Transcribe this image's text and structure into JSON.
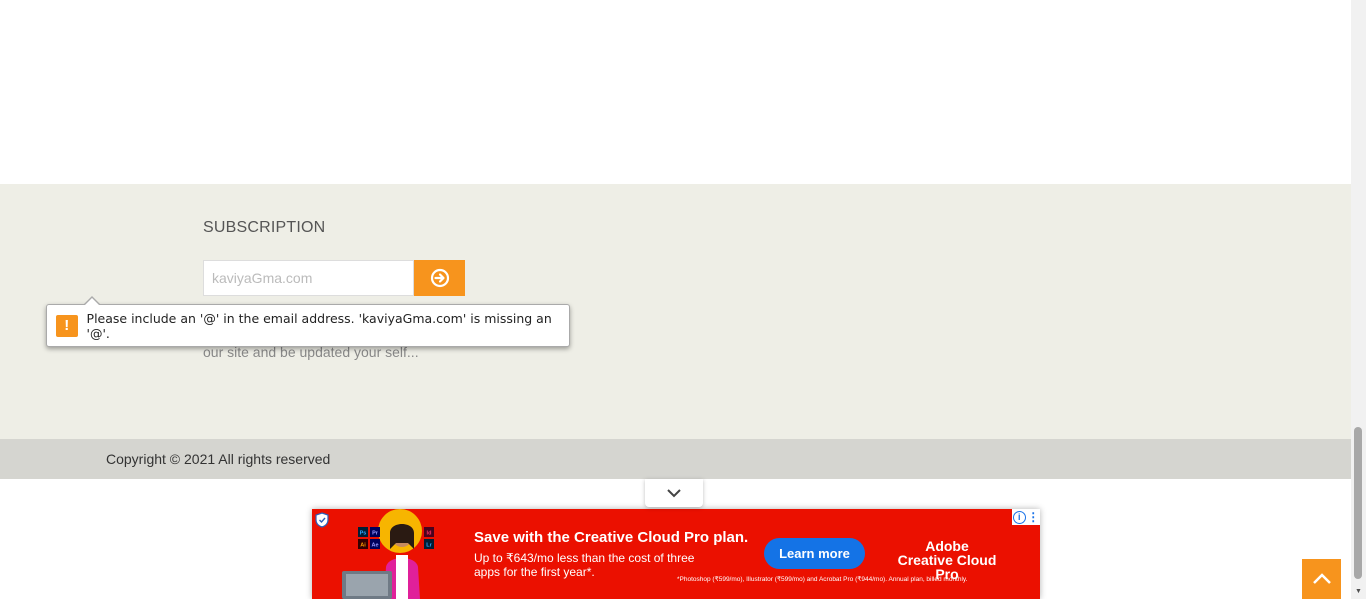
{
  "subscription": {
    "title": "SUBSCRIPTION",
    "email_value": "kaviyaGma.com",
    "submit_icon": "arrow-circle-right-icon",
    "description": "our site and be updated your self..."
  },
  "validation": {
    "icon": "warning-icon",
    "glyph": "!",
    "message": "Please include an '@' in the email address. 'kaviyaGma.com' is missing an '@'."
  },
  "footer": {
    "copyright": "Copyright © 2021 All rights reserved"
  },
  "ad": {
    "headline": "Save with the Creative Cloud Pro plan.",
    "subtext": "Up to ₹643/mo less than the cost of three apps for the first year*.",
    "cta": "Learn more",
    "brand_top": "Adobe",
    "brand_bottom": "Creative Cloud Pro",
    "fineprint": "*Photoshop (₹599/mo), Illustrator (₹599/mo) and Acrobat Pro (₹944/mo). Annual plan, billed monthly.",
    "info_glyph": "i",
    "menu_glyph": "⋮",
    "app_tiles": [
      "Ps",
      "Pr",
      "Id",
      "Ai",
      "Ae",
      "Lr"
    ]
  },
  "colors": {
    "accent": "#f7941d",
    "section_bg": "#eeeee6",
    "footer_bg": "#d5d5d0",
    "ad_bg": "#eb1000",
    "ad_button": "#1473e6"
  }
}
